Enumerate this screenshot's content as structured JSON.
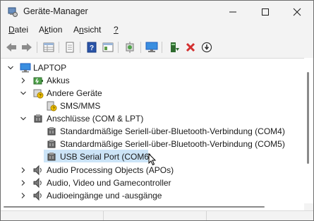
{
  "window": {
    "title": "Geräte-Manager"
  },
  "menu": {
    "file": "Datei",
    "action": "Aktion",
    "view": "Ansicht",
    "help": "?"
  },
  "toolbar": {
    "icons": [
      "back-arrow-icon",
      "forward-arrow-icon",
      "properties-grid-icon",
      "document-icon",
      "help-book-icon",
      "view-pane-icon",
      "scan-hardware-icon",
      "monitor-icon",
      "update-driver-icon",
      "uninstall-x-icon",
      "disable-device-icon"
    ]
  },
  "tree": {
    "root": "LAPTOP",
    "akkus": "Akkus",
    "andere": "Andere Geräte",
    "sms": "SMS/MMS",
    "anschluesse": "Anschlüsse (COM & LPT)",
    "com4": "Standardmäßige Seriell-über-Bluetooth-Verbindung (COM4)",
    "com5": "Standardmäßige Seriell-über-Bluetooth-Verbindung (COM5)",
    "usb": "USB Serial Port (COM6)",
    "apo": "Audio Processing Objects (APOs)",
    "avg": "Audio, Video und Gamecontroller",
    "audio_io": "Audioeingänge und -ausgänge"
  },
  "colors": {
    "selection": "#cce4f7",
    "delete_red": "#d32f2f",
    "accent_blue": "#1f5fbf"
  }
}
